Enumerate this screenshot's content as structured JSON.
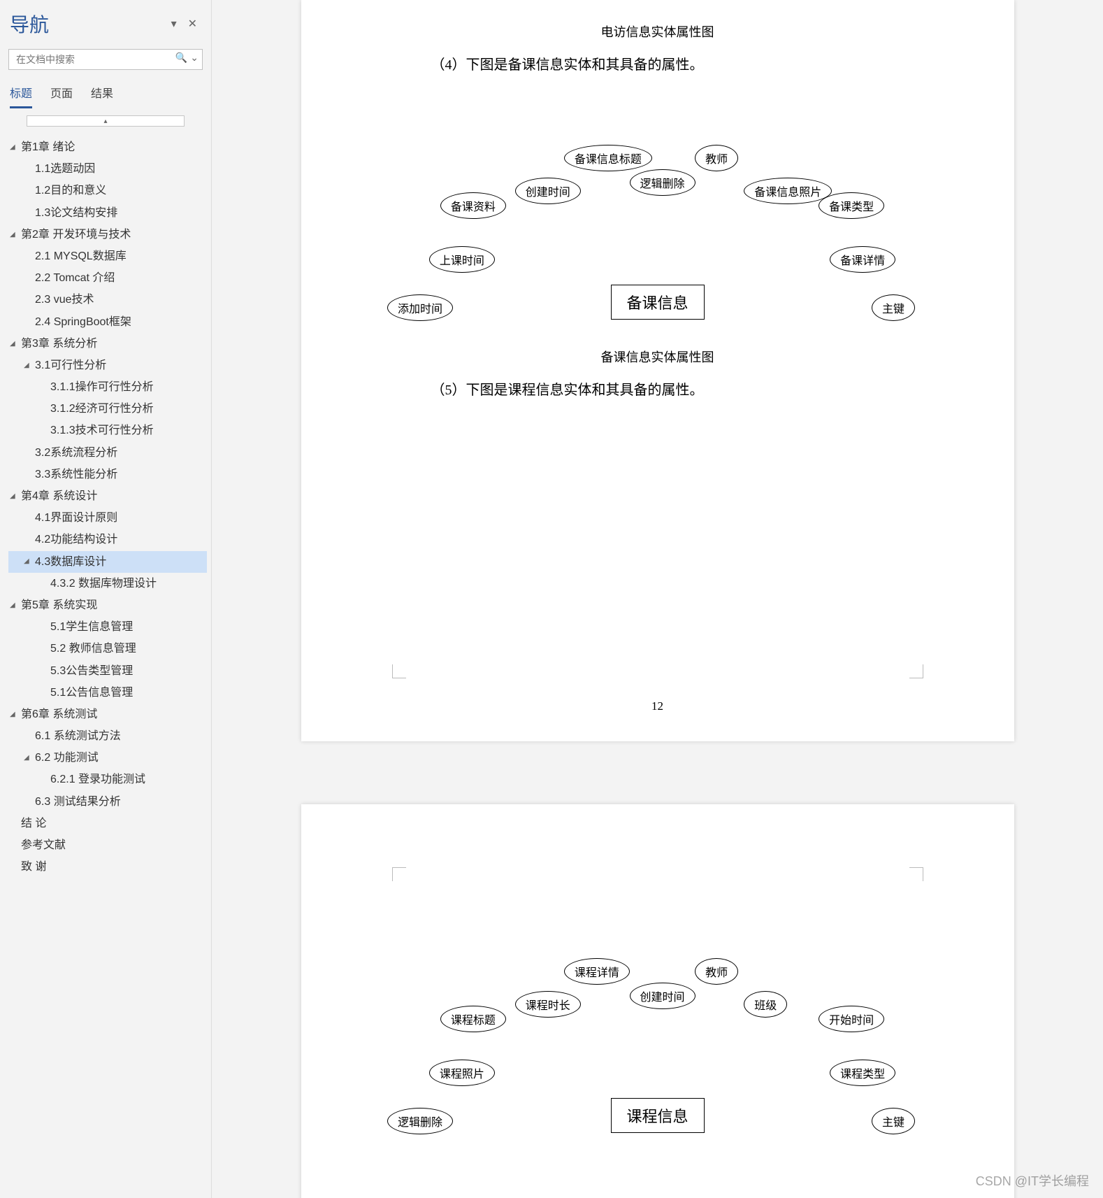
{
  "nav": {
    "title": "导航",
    "search_placeholder": "在文档中搜索",
    "tabs": [
      {
        "label": "标题",
        "active": true
      },
      {
        "label": "页面",
        "active": false
      },
      {
        "label": "结果",
        "active": false
      }
    ],
    "tree": [
      {
        "label": "第1章 绪论",
        "level": 0,
        "caret": true
      },
      {
        "label": "1.1选题动因",
        "level": 1
      },
      {
        "label": "1.2目的和意义",
        "level": 1
      },
      {
        "label": "1.3论文结构安排",
        "level": 1
      },
      {
        "label": "第2章 开发环境与技术",
        "level": 0,
        "caret": true
      },
      {
        "label": "2.1 MYSQL数据库",
        "level": 1
      },
      {
        "label": "2.2 Tomcat 介绍",
        "level": 1
      },
      {
        "label": "2.3 vue技术",
        "level": 1
      },
      {
        "label": "2.4 SpringBoot框架",
        "level": 1
      },
      {
        "label": "第3章 系统分析",
        "level": 0,
        "caret": true
      },
      {
        "label": "3.1可行性分析",
        "level": 1,
        "caret": true
      },
      {
        "label": "3.1.1操作可行性分析",
        "level": 2
      },
      {
        "label": "3.1.2经济可行性分析",
        "level": 2
      },
      {
        "label": "3.1.3技术可行性分析",
        "level": 2
      },
      {
        "label": "3.2系统流程分析",
        "level": 1
      },
      {
        "label": "3.3系统性能分析",
        "level": 1
      },
      {
        "label": "第4章 系统设计",
        "level": 0,
        "caret": true
      },
      {
        "label": "4.1界面设计原则",
        "level": 1
      },
      {
        "label": "4.2功能结构设计",
        "level": 1
      },
      {
        "label": "4.3数据库设计",
        "level": 1,
        "caret": true,
        "selected": true
      },
      {
        "label": "4.3.2 数据库物理设计",
        "level": 2
      },
      {
        "label": "第5章 系统实现",
        "level": 0,
        "caret": true
      },
      {
        "label": "5.1学生信息管理",
        "level": 2
      },
      {
        "label": "5.2 教师信息管理",
        "level": 2
      },
      {
        "label": "5.3公告类型管理",
        "level": 2
      },
      {
        "label": "5.1公告信息管理",
        "level": 2
      },
      {
        "label": "第6章 系统测试",
        "level": 0,
        "caret": true
      },
      {
        "label": "6.1 系统测试方法",
        "level": 1
      },
      {
        "label": "6.2 功能测试",
        "level": 1,
        "caret": true
      },
      {
        "label": "6.2.1 登录功能测试",
        "level": 2
      },
      {
        "label": "6.3 测试结果分析",
        "level": 1
      },
      {
        "label": "结  论",
        "level": 0
      },
      {
        "label": "参考文献",
        "level": 0
      },
      {
        "label": "致  谢",
        "level": 0
      }
    ]
  },
  "doc": {
    "page1": {
      "caption_top": "电访信息实体属性图",
      "heading": "（4）下图是备课信息实体和其具备的属性。",
      "entity": "备课信息",
      "attrs": [
        "添加时间",
        "上课时间",
        "备课资料",
        "创建时间",
        "备课信息标题",
        "逻辑删除",
        "教师",
        "备课信息照片",
        "备课类型",
        "备课详情",
        "主键"
      ],
      "caption_bottom": "备课信息实体属性图",
      "heading2": "（5）下图是课程信息实体和其具备的属性。",
      "page_number": "12"
    },
    "page2": {
      "entity": "课程信息",
      "attrs": [
        "逻辑删除",
        "课程照片",
        "课程标题",
        "课程时长",
        "课程详情",
        "创建时间",
        "教师",
        "班级",
        "开始时间",
        "课程类型",
        "主键"
      ]
    }
  },
  "watermark": "CSDN @IT学长编程"
}
